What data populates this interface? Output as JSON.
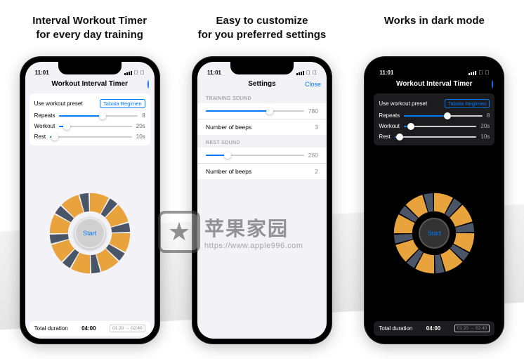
{
  "captions": {
    "p1l1": "Interval Workout Timer",
    "p1l2": "for every day training",
    "p2l1": "Easy to customize",
    "p2l2": "for you preferred settings",
    "p3": "Works in dark mode"
  },
  "status": {
    "time": "11:01"
  },
  "app": {
    "title": "Workout Interval Timer",
    "preset_label": "Use workout preset",
    "preset_button": "Tabata Regimen",
    "rows": {
      "repeats": {
        "label": "Repeats",
        "value": "8"
      },
      "workout": {
        "label": "Workout",
        "value": "20s"
      },
      "rest": {
        "label": "Rest",
        "value": "10s"
      }
    },
    "start": "Start",
    "footer": {
      "label": "Total duration",
      "value": "04:00",
      "range": "01:20 → 02:40"
    }
  },
  "settings": {
    "title": "Settings",
    "close": "Close",
    "sections": {
      "training": {
        "header": "TRAINING SOUND",
        "slider_value": "780",
        "beeps_label": "Number of beeps",
        "beeps_value": "3"
      },
      "rest": {
        "header": "REST SOUND",
        "slider_value": "260",
        "beeps_label": "Number of beeps",
        "beeps_value": "2"
      }
    }
  },
  "watermark": {
    "cn": "苹果家园",
    "url": "https://www.apple996.com"
  },
  "colors": {
    "accent": "#007aff",
    "work": "#e8a33d",
    "rest": "#4a5568"
  }
}
